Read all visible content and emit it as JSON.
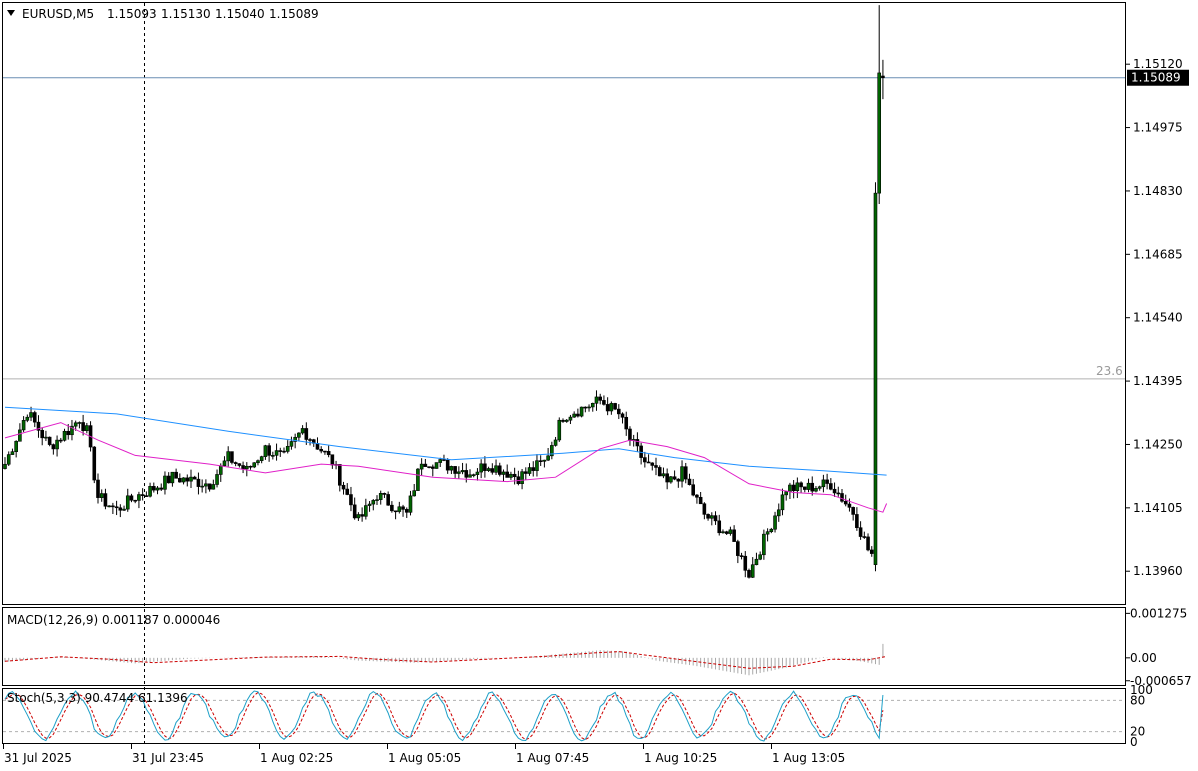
{
  "main_panel": {
    "symbol": "EURUSD,M5",
    "ohlc": [
      "1.15093",
      "1.15130",
      "1.15040",
      "1.15089"
    ],
    "current_price_label": "1.15089",
    "fibo_label": "23.6",
    "colors": {
      "bull_body": "#006400",
      "bear_body": "#000000",
      "ma_fast": "#e020c8",
      "ma_slow": "#1e90ff",
      "price_line": "#6a8db3",
      "fibo_line": "#b0b0b0"
    }
  },
  "macd_panel": {
    "title": "MACD(12,26,9) 0.001187 0.000046",
    "colors": {
      "hist": "#a9a9a9",
      "signal": "#cc0000"
    }
  },
  "stoch_panel": {
    "title": "Stoch(5,3,3) 90.4744 61.1396",
    "colors": {
      "main": "#1ea0c8",
      "signal": "#cc0000"
    }
  },
  "chart_data": [
    {
      "type": "candlestick",
      "title": "EURUSD,M5",
      "ylim": [
        1.13885,
        1.1526
      ],
      "y_ticks": [
        "1.15120",
        "1.14975",
        "1.14830",
        "1.14685",
        "1.14540",
        "1.14395",
        "1.14250",
        "1.14105",
        "1.13960"
      ],
      "x_ticks": [
        "31 Jul 2025",
        "31 Jul 23:45",
        "1 Aug 02:25",
        "1 Aug 05:05",
        "1 Aug 07:45",
        "1 Aug 10:25",
        "1 Aug 13:05"
      ],
      "fibonacci_level": {
        "label": "23.6",
        "price": 1.144
      },
      "current_price": 1.15089,
      "anchor_points": [
        [
          0,
          1.14205
        ],
        [
          6,
          1.14325
        ],
        [
          12,
          1.14245
        ],
        [
          18,
          1.1429
        ],
        [
          20,
          1.1431
        ],
        [
          22,
          1.1428
        ],
        [
          25,
          1.1413
        ],
        [
          30,
          1.141
        ],
        [
          35,
          1.1413
        ],
        [
          40,
          1.1415
        ],
        [
          45,
          1.14175
        ],
        [
          55,
          1.1416
        ],
        [
          60,
          1.1422
        ],
        [
          65,
          1.1419
        ],
        [
          70,
          1.1424
        ],
        [
          75,
          1.1422
        ],
        [
          80,
          1.14285
        ],
        [
          88,
          1.1421
        ],
        [
          95,
          1.14075
        ],
        [
          100,
          1.14135
        ],
        [
          108,
          1.1409
        ],
        [
          112,
          1.14215
        ],
        [
          120,
          1.142
        ],
        [
          125,
          1.14185
        ],
        [
          130,
          1.14205
        ],
        [
          138,
          1.14175
        ],
        [
          145,
          1.1421
        ],
        [
          150,
          1.14315
        ],
        [
          160,
          1.1435
        ],
        [
          165,
          1.1432
        ],
        [
          168,
          1.1426
        ],
        [
          172,
          1.1421
        ],
        [
          178,
          1.1416
        ],
        [
          182,
          1.14185
        ],
        [
          188,
          1.1409
        ],
        [
          195,
          1.1404
        ],
        [
          200,
          1.13955
        ],
        [
          205,
          1.1405
        ],
        [
          210,
          1.1415
        ],
        [
          215,
          1.1415
        ],
        [
          222,
          1.1416
        ],
        [
          228,
          1.14095
        ],
        [
          232,
          1.1401
        ],
        [
          236,
          1.13965
        ]
      ],
      "spike": [
        {
          "open": 1.13975,
          "high": 1.1485,
          "low": 1.1396,
          "close": 1.14825
        },
        {
          "open": 1.14825,
          "high": 1.15255,
          "low": 1.148,
          "close": 1.151
        },
        {
          "open": 1.15093,
          "high": 1.1513,
          "low": 1.1504,
          "close": 1.15089
        }
      ],
      "series": [
        {
          "kind": "moving_average",
          "color": "#1e90ff",
          "points": [
            [
              0,
              1.14335
            ],
            [
              30,
              1.1432
            ],
            [
              60,
              1.1428
            ],
            [
              90,
              1.14245
            ],
            [
              120,
              1.14215
            ],
            [
              150,
              1.1423
            ],
            [
              165,
              1.1424
            ],
            [
              180,
              1.1422
            ],
            [
              200,
              1.142
            ],
            [
              220,
              1.1419
            ],
            [
              237,
              1.1418
            ]
          ]
        },
        {
          "kind": "moving_average",
          "color": "#e020c8",
          "points": [
            [
              0,
              1.14265
            ],
            [
              15,
              1.143
            ],
            [
              25,
              1.1426
            ],
            [
              35,
              1.14225
            ],
            [
              55,
              1.14205
            ],
            [
              70,
              1.14185
            ],
            [
              85,
              1.14205
            ],
            [
              95,
              1.142
            ],
            [
              115,
              1.14175
            ],
            [
              135,
              1.14165
            ],
            [
              148,
              1.14175
            ],
            [
              160,
              1.1424
            ],
            [
              168,
              1.1426
            ],
            [
              178,
              1.14245
            ],
            [
              188,
              1.1422
            ],
            [
              200,
              1.1416
            ],
            [
              212,
              1.1414
            ],
            [
              222,
              1.14135
            ],
            [
              232,
              1.14105
            ],
            [
              236,
              1.14095
            ],
            [
              237,
              1.14115
            ]
          ]
        }
      ]
    },
    {
      "type": "macd",
      "title": "MACD(12,26,9) 0.001187 0.000046",
      "y_ticks": [
        "0.001275",
        "0.00",
        "-0.000657"
      ],
      "ylim": [
        -0.00075,
        0.0014
      ],
      "series": [
        {
          "kind": "histogram",
          "points": [
            [
              0,
              -0.00012
            ],
            [
              15,
              4e-05
            ],
            [
              25,
              -6e-05
            ],
            [
              35,
              -0.00016
            ],
            [
              50,
              -2e-05
            ],
            [
              65,
              2e-05
            ],
            [
              85,
              5e-05
            ],
            [
              95,
              -8e-05
            ],
            [
              110,
              -0.00014
            ],
            [
              125,
              -4e-05
            ],
            [
              140,
              2e-05
            ],
            [
              150,
              0.00012
            ],
            [
              160,
              0.00022
            ],
            [
              167,
              0.00018
            ],
            [
              175,
              -8e-05
            ],
            [
              185,
              -0.00022
            ],
            [
              200,
              -0.0005
            ],
            [
              210,
              -0.00028
            ],
            [
              220,
              2e-05
            ],
            [
              230,
              -0.0001
            ],
            [
              235,
              -0.0002
            ],
            [
              236,
              0.0004
            ],
            [
              237,
              0.0012
            ]
          ]
        },
        {
          "kind": "signal",
          "points": [
            [
              0,
              -0.0001
            ],
            [
              15,
              3e-05
            ],
            [
              28,
              -4e-05
            ],
            [
              40,
              -0.00014
            ],
            [
              55,
              -6e-05
            ],
            [
              70,
              2e-05
            ],
            [
              90,
              4e-05
            ],
            [
              100,
              -4e-05
            ],
            [
              115,
              -0.00012
            ],
            [
              130,
              -4e-05
            ],
            [
              145,
              4e-05
            ],
            [
              158,
              0.00014
            ],
            [
              165,
              0.00018
            ],
            [
              175,
              4e-05
            ],
            [
              188,
              -0.00014
            ],
            [
              200,
              -0.0003
            ],
            [
              212,
              -0.00024
            ],
            [
              222,
              -4e-05
            ],
            [
              232,
              -6e-05
            ],
            [
              237,
              4e-05
            ]
          ]
        }
      ]
    },
    {
      "type": "stochastic",
      "title": "Stoch(5,3,3) 90.4744 61.1396",
      "y_ticks": [
        "100",
        "80",
        "20",
        "0"
      ],
      "ylim": [
        0,
        100
      ],
      "levels": [
        80,
        20
      ]
    }
  ]
}
